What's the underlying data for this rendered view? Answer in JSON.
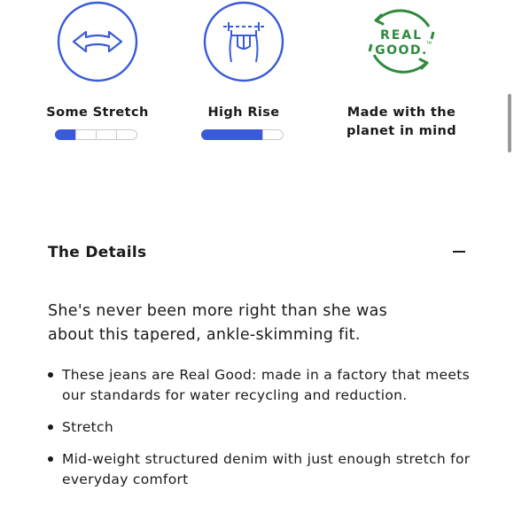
{
  "features": [
    {
      "icon": "stretch-arrows-icon",
      "label": "Some Stretch",
      "meter_filled": 1,
      "meter_total": 4
    },
    {
      "icon": "high-rise-waist-icon",
      "label": "High Rise",
      "meter_filled": 3,
      "meter_total": 4
    },
    {
      "icon": "real-good-logo",
      "label": "Made with the planet in mind",
      "logo_text_top": "REAL",
      "logo_text_bottom": "GOOD.",
      "logo_tm": "TM"
    }
  ],
  "details": {
    "title": "The Details",
    "collapse_symbol": "−",
    "intro": "She's never been more right than she was about this tapered, ankle-skimming fit.",
    "bullets": [
      "These jeans are Real Good: made in a factory that meets our standards for water recycling and reduction.",
      "Stretch",
      "Mid-weight structured denim with just enough stretch for everyday comfort"
    ]
  },
  "colors": {
    "accent_blue": "#3a5bd9",
    "real_good_green": "#2e8b3e",
    "meter_empty_border": "#c8c8d0"
  }
}
